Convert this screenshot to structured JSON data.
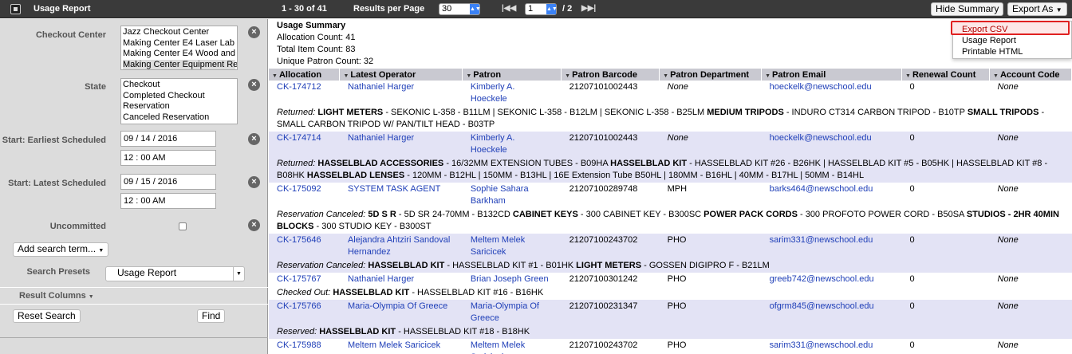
{
  "app": {
    "title": "Usage Report"
  },
  "toolbar": {
    "range": "1 - 30 of 41",
    "rpp_label": "Results per Page",
    "rpp_value": "30",
    "page_value": "1",
    "page_total": "/ 2",
    "hide_summary": "Hide Summary",
    "export_as": "Export As"
  },
  "export_menu": [
    "Export CSV",
    "Usage Report",
    "Printable HTML"
  ],
  "filters": {
    "checkout_center_label": "Checkout Center",
    "checkout_centers": [
      "Jazz Checkout Center",
      "Making Center E4 Laser Lab",
      "Making Center E4 Wood and M",
      "Making Center Equipment Re"
    ],
    "state_label": "State",
    "states": [
      "Checkout",
      "Completed Checkout",
      "Reservation",
      "Canceled Reservation"
    ],
    "earliest_label": "Start: Earliest Scheduled",
    "earliest_date": "09 / 14 / 2016",
    "earliest_time": "12 : 00 AM",
    "latest_label": "Start: Latest Scheduled",
    "latest_date": "09 / 15 / 2016",
    "latest_time": "12 : 00 AM",
    "uncommitted_label": "Uncommitted",
    "add_term": "Add search term...",
    "presets_label": "Search Presets",
    "preset_value": "Usage Report",
    "result_columns": "Result Columns",
    "reset": "Reset Search",
    "find": "Find"
  },
  "summary": {
    "title": "Usage Summary",
    "lines": [
      "Allocation Count: 41",
      "Total Item Count: 83",
      "Unique Patron Count: 32"
    ]
  },
  "columns": [
    "Allocation",
    "Latest Operator",
    "Patron",
    "Patron Barcode",
    "Patron Department",
    "Patron Email",
    "Renewal Count",
    "Account Code"
  ],
  "rows": [
    {
      "alloc": "CK-174712",
      "op": "Nathaniel Harger",
      "patron": "Kimberly A. Hoeckele",
      "barcode": "21207101002443",
      "dept": "None",
      "email": "hoeckelk@newschool.edu",
      "renew": "0",
      "acct": "None",
      "detail": [
        {
          "t": "Returned: ",
          "s": "i"
        },
        {
          "t": "LIGHT METERS",
          "s": "b"
        },
        {
          "t": " - SEKONIC L-358 - B11LM | SEKONIC L-358 - B12LM | SEKONIC L-358 - B25LM "
        },
        {
          "t": "MEDIUM TRIPODS",
          "s": "b"
        },
        {
          "t": " - INDURO CT314 CARBON TRIPOD - B10TP "
        },
        {
          "t": "SMALL TRIPODS",
          "s": "b"
        },
        {
          "t": " - SMALL CARBON TRIPOD W/ PAN/TILT HEAD - B03TP"
        }
      ]
    },
    {
      "alloc": "CK-174714",
      "op": "Nathaniel Harger",
      "patron": "Kimberly A. Hoeckele",
      "barcode": "21207101002443",
      "dept": "None",
      "email": "hoeckelk@newschool.edu",
      "renew": "0",
      "acct": "None",
      "detail": [
        {
          "t": "Returned: ",
          "s": "i"
        },
        {
          "t": "HASSELBLAD ACCESSORIES",
          "s": "b"
        },
        {
          "t": " - 16/32MM EXTENSION TUBES - B09HA "
        },
        {
          "t": "HASSELBLAD KIT",
          "s": "b"
        },
        {
          "t": " - HASSELBLAD KIT #26 - B26HK | HASSELBLAD KIT #5 - B05HK | HASSELBLAD KIT #8 - B08HK "
        },
        {
          "t": "HASSELBLAD LENSES",
          "s": "b"
        },
        {
          "t": " - 120MM - B12HL | 150MM - B13HL | 16E Extension Tube B50HL | 180MM - B16HL | 40MM - B17HL | 50MM - B14HL"
        }
      ]
    },
    {
      "alloc": "CK-175092",
      "op": "SYSTEM TASK AGENT",
      "patron": "Sophie Sahara Barkham",
      "barcode": "21207100289748",
      "dept": "MPH",
      "email": "barks464@newschool.edu",
      "renew": "0",
      "acct": "None",
      "detail": [
        {
          "t": "Reservation Canceled: ",
          "s": "i"
        },
        {
          "t": "5D S R",
          "s": "b"
        },
        {
          "t": " - 5D SR 24-70MM - B132CD "
        },
        {
          "t": "CABINET KEYS",
          "s": "b"
        },
        {
          "t": " - 300 CABINET KEY - B300SC "
        },
        {
          "t": "POWER PACK CORDS",
          "s": "b"
        },
        {
          "t": " - 300 PROFOTO POWER CORD - B50SA "
        },
        {
          "t": "STUDIOS - 2HR 40MIN BLOCKS",
          "s": "b"
        },
        {
          "t": " - 300 STUDIO KEY - B300ST"
        }
      ]
    },
    {
      "alloc": "CK-175646",
      "op": "Alejandra Ahtziri Sandoval Hernandez",
      "patron": "Meltem Melek Saricicek",
      "barcode": "21207100243702",
      "dept": "PHO",
      "email": "sarim331@newschool.edu",
      "renew": "0",
      "acct": "None",
      "detail": [
        {
          "t": "Reservation Canceled: ",
          "s": "i"
        },
        {
          "t": "HASSELBLAD KIT",
          "s": "b"
        },
        {
          "t": " - HASSELBLAD KIT #1 - B01HK "
        },
        {
          "t": "LIGHT METERS",
          "s": "b"
        },
        {
          "t": " - GOSSEN DIGIPRO F - B21LM"
        }
      ]
    },
    {
      "alloc": "CK-175767",
      "op": "Nathaniel Harger",
      "patron": "Brian Joseph Green",
      "barcode": "21207100301242",
      "dept": "PHO",
      "email": "greeb742@newschool.edu",
      "renew": "0",
      "acct": "None",
      "detail": [
        {
          "t": "Checked Out: ",
          "s": "i"
        },
        {
          "t": "HASSELBLAD KIT",
          "s": "b"
        },
        {
          "t": " - HASSELBLAD KIT #16 - B16HK"
        }
      ]
    },
    {
      "alloc": "CK-175766",
      "op": "Maria-Olympia Of Greece",
      "patron": "Maria-Olympia Of Greece",
      "barcode": "21207100231347",
      "dept": "PHO",
      "email": "ofgrm845@newschool.edu",
      "renew": "0",
      "acct": "None",
      "detail": [
        {
          "t": "Reserved: ",
          "s": "i"
        },
        {
          "t": "HASSELBLAD KIT",
          "s": "b"
        },
        {
          "t": " - HASSELBLAD KIT #18 - B18HK"
        }
      ]
    },
    {
      "alloc": "CK-175988",
      "op": "Meltem Melek Saricicek",
      "patron": "Meltem Melek Saricicek",
      "barcode": "21207100243702",
      "dept": "PHO",
      "email": "sarim331@newschool.edu",
      "renew": "0",
      "acct": "None",
      "detail": []
    }
  ]
}
